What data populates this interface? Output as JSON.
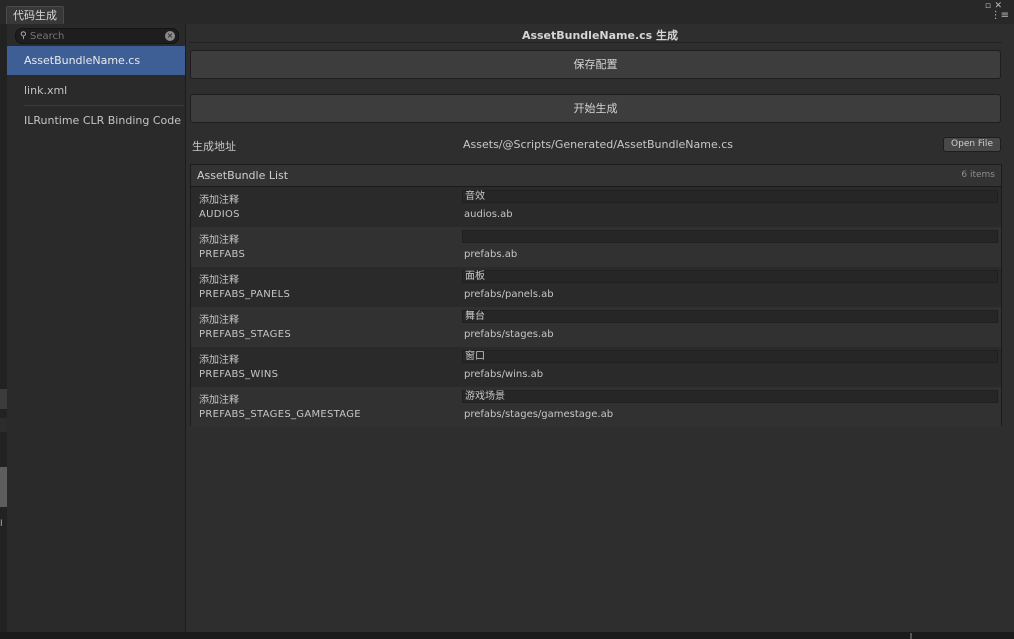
{
  "window": {
    "tab_title": "代码生成",
    "max_icon": "▫",
    "close_icon": "✕",
    "menu_icon": "⋮≡"
  },
  "sidebar": {
    "search_placeholder": "Search",
    "items": [
      {
        "label": "AssetBundleName.cs",
        "selected": true
      },
      {
        "label": "link.xml",
        "selected": false
      },
      {
        "label": "ILRuntime CLR Binding Code",
        "selected": false
      }
    ],
    "left_edge_text": "I"
  },
  "main": {
    "title": "AssetBundleName.cs 生成",
    "save_button": "保存配置",
    "generate_button": "开始生成",
    "output_label": "生成地址",
    "output_path": "Assets/@Scripts/Generated/AssetBundleName.cs",
    "open_file_button": "Open File",
    "list": {
      "title": "AssetBundle List",
      "count": "6 items",
      "rows": [
        {
          "note_label": "添加注释",
          "comment": "音效",
          "key": "AUDIOS",
          "path": "audios.ab"
        },
        {
          "note_label": "添加注释",
          "comment": "",
          "key": "PREFABS",
          "path": "prefabs.ab"
        },
        {
          "note_label": "添加注释",
          "comment": "面板",
          "key": "PREFABS_PANELS",
          "path": "prefabs/panels.ab"
        },
        {
          "note_label": "添加注释",
          "comment": "舞台",
          "key": "PREFABS_STAGES",
          "path": "prefabs/stages.ab"
        },
        {
          "note_label": "添加注释",
          "comment": "窗口",
          "key": "PREFABS_WINS",
          "path": "prefabs/wins.ab"
        },
        {
          "note_label": "添加注释",
          "comment": "游戏场景",
          "key": "PREFABS_STAGES_GAMESTAGE",
          "path": "prefabs/stages/gamestage.ab"
        }
      ]
    }
  },
  "colors": {
    "selection": "#3e5f96",
    "panel_bg": "#2e2e2e",
    "sidebar_bg": "#2a2a2a",
    "text": "#c8c8c8"
  }
}
